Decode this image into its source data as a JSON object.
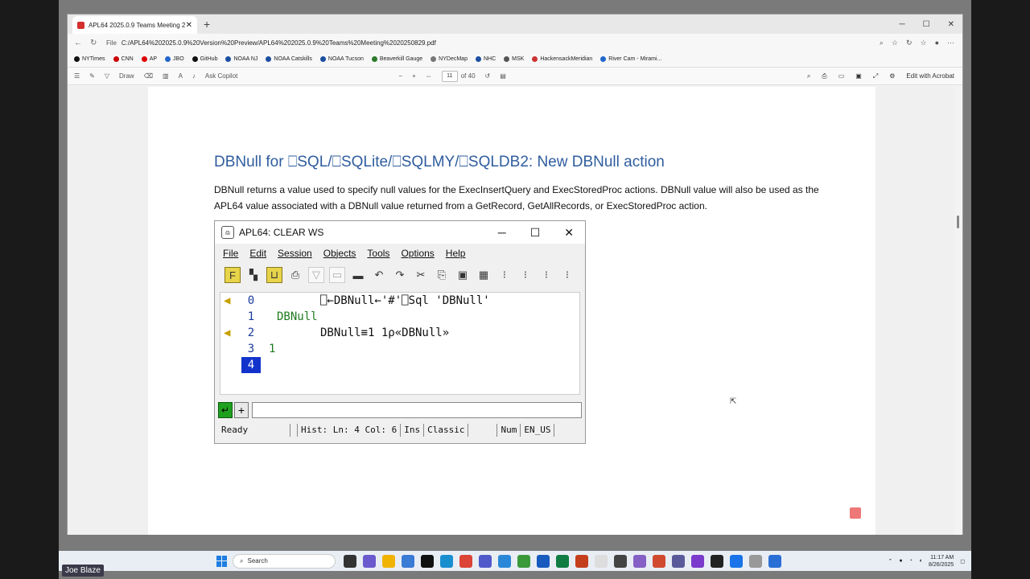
{
  "browser": {
    "tab_title": "APL64 2025.0.9 Teams Meeting 2",
    "new_tab": "+",
    "address_prefix": "File",
    "url": "C:/APL64%202025.0.9%20Version%20Preview/APL64%202025.0.9%20Teams%20Meeting%2020250829.pdf",
    "bookmarks": [
      "NYTimes",
      "CNN",
      "AP",
      "JBO",
      "GitHub",
      "NOAA NJ",
      "NOAA Catskills",
      "NOAA Tucson",
      "Beaverkill Gauge",
      "NYDecMap",
      "NHC",
      "MSK",
      "HackensackMeridian",
      "River Cam - Mirami..."
    ],
    "pdf_toolbar": {
      "draw": "Draw",
      "ask_copilot": "Ask Copilot",
      "page_current": "11",
      "page_total": "of 40",
      "edit_with_acrobat": "Edit with Acrobat"
    }
  },
  "document": {
    "title": "DBNull for ⎕SQL/⎕SQLite/⎕SQLMY/⎕SQLDB2: New DBNull action",
    "body": "DBNull returns a value used to specify null values for the ExecInsertQuery and ExecStoredProc actions.  DBNull value will also be used as the APL64 value associated with a DBNull value returned from a GetRecord, GetAllRecords, or ExecStoredProc action."
  },
  "apl_window": {
    "title": "APL64: CLEAR WS",
    "menu": [
      "File",
      "Edit",
      "Session",
      "Objects",
      "Tools",
      "Options",
      "Help"
    ],
    "lines": [
      {
        "num": "0",
        "text": "⎕←DBNull←'#'⎕Sql 'DBNull'",
        "style": "blk"
      },
      {
        "num": "1",
        "text": "DBNull",
        "style": "grn"
      },
      {
        "num": "2",
        "text": "DBNull≡1 1⍴«DBNull»",
        "style": "blk"
      },
      {
        "num": "3",
        "text": "1",
        "style": "grn"
      },
      {
        "num": "4",
        "text": "",
        "style": "blk"
      }
    ],
    "status": {
      "ready": "Ready",
      "hist": "Hist: Ln: 4 Col: 6",
      "ins": "Ins",
      "mode": "Classic",
      "num": "Num",
      "locale": "EN_US"
    }
  },
  "taskbar": {
    "search": "Search",
    "time": "11:17 AM",
    "date": "8/26/2025"
  },
  "presenter_name": "Joe Blaze"
}
